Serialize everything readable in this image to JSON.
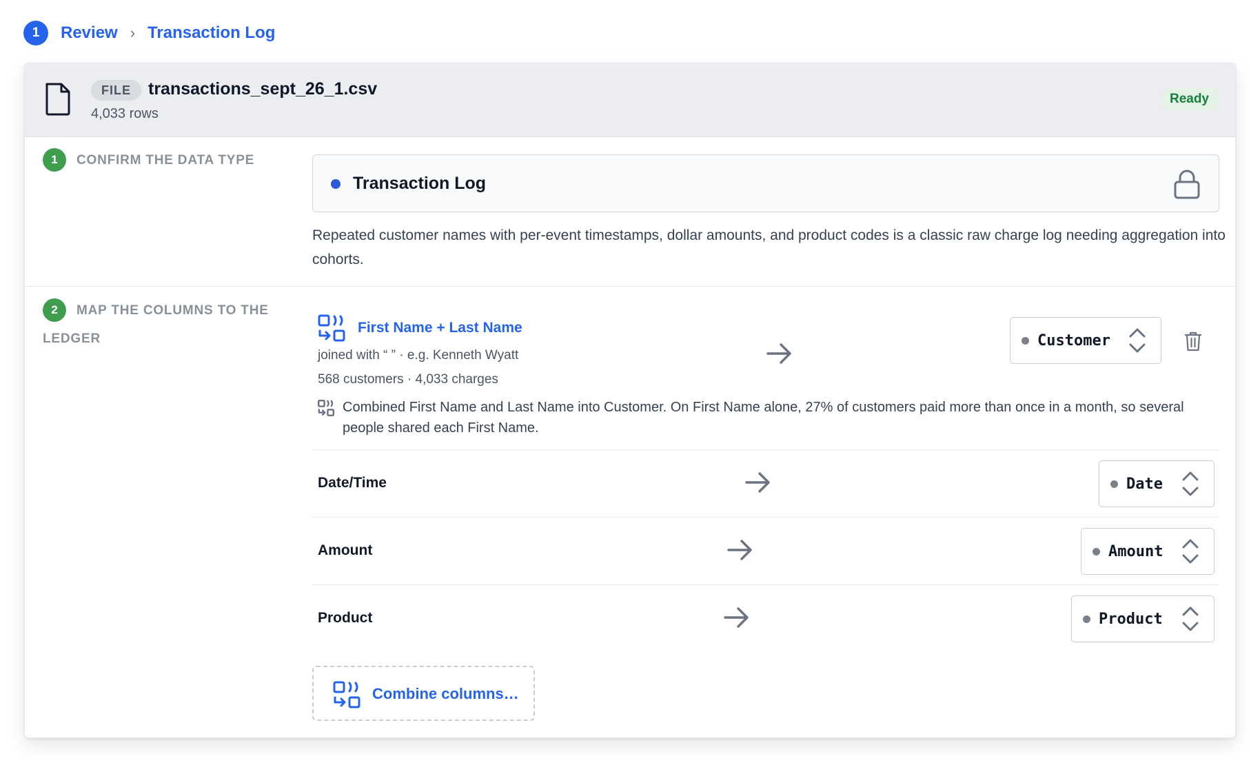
{
  "breadcrumb": {
    "step": "1",
    "items": [
      "Review",
      "Transaction Log"
    ],
    "separator": "›"
  },
  "file": {
    "badge": "FILE",
    "name": "transactions_sept_26_1.csv",
    "rows": "4,033 rows",
    "status": "Ready"
  },
  "sections": {
    "confirm": {
      "number": "1",
      "title": "Confirm the data type",
      "type_label": "Transaction Log",
      "description": "Repeated customer names with per-event timestamps, dollar amounts, and product codes is a classic raw charge log needing aggregation into cohorts."
    },
    "map": {
      "number": "2",
      "title": "Map the columns to the ledger"
    }
  },
  "mapping": {
    "combined": {
      "title": "First Name + Last Name",
      "joined": "joined with “ ” · e.g. Kenneth Wyatt",
      "counts": "568 customers · 4,033 charges",
      "note": "Combined First Name and Last Name into Customer. On First Name alone, 27% of customers paid more than once in a month, so several people shared each First Name.",
      "target": "Customer"
    },
    "rows": [
      {
        "source": "Date/Time",
        "target": "Date"
      },
      {
        "source": "Amount",
        "target": "Amount"
      },
      {
        "source": "Product",
        "target": "Product"
      }
    ],
    "combine_button": "Combine columns…"
  },
  "icons": {
    "file": "file-icon",
    "lock": "lock-icon",
    "combine": "combine-columns-icon",
    "arrow": "arrow-right-icon",
    "select": "chevron-up-down-icon",
    "delete": "trash-icon"
  },
  "colors": {
    "accent": "#2563eb",
    "success": "#3f9d4e",
    "ready_text": "#15803d",
    "ready_bg": "#e5f3e6"
  }
}
